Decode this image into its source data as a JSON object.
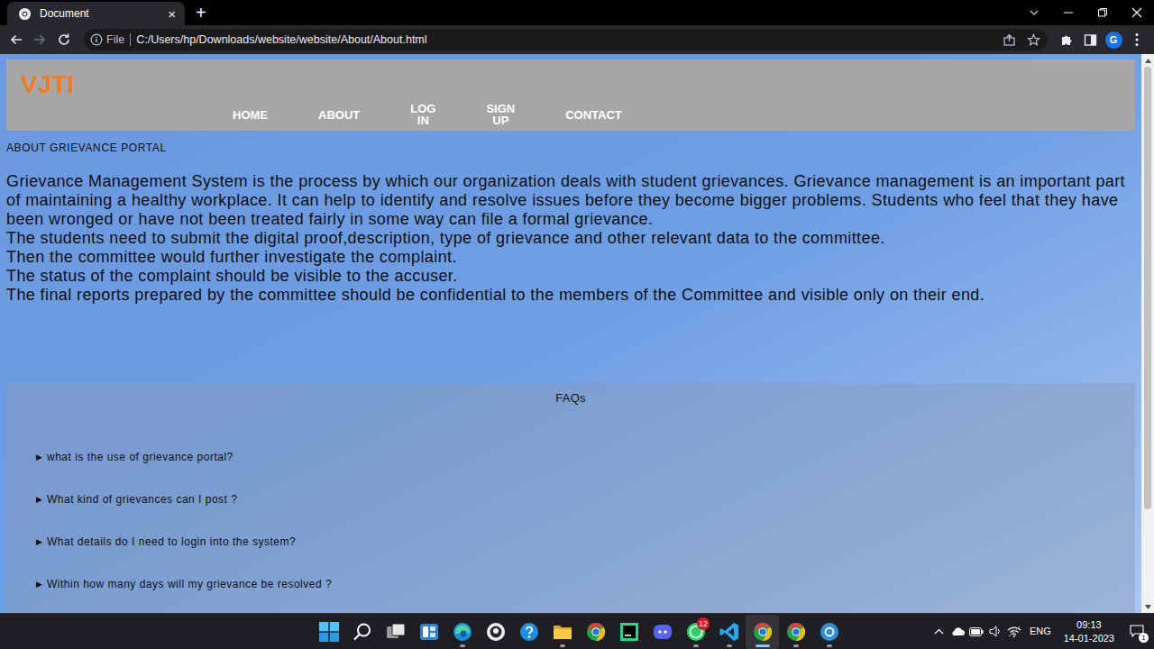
{
  "browser": {
    "tabs": [
      {
        "title": "Document",
        "close": "×",
        "selected": true
      }
    ],
    "new_tab": "+",
    "back_enabled": true,
    "forward_enabled": false,
    "address": {
      "scheme": "File",
      "url": "C:/Users/hp/Downloads/website/website/About/About.html"
    },
    "profile": "G"
  },
  "page": {
    "logo": "VJTI",
    "nav": [
      {
        "label": "HOME"
      },
      {
        "label": "ABOUT"
      },
      {
        "label": "LOG IN"
      },
      {
        "label": "SIGN UP"
      },
      {
        "label": "CONTACT"
      }
    ],
    "section_label": "ABOUT GRIEVANCE PORTAL",
    "paragraph_lines": [
      "Grievance Management System is the process by which our organization deals with student grievances. Grievance management is an important part of maintaining a healthy workplace. It can help to identify and resolve issues before they become bigger problems. Students who feel that they have been wronged or have not been treated fairly in some way can file a formal grievance.",
      "The students need to submit the digital proof,description, type of grievance and other relevant data to the committee.",
      "Then the committee would further investigate the complaint.",
      "The status of the complaint should be visible to the accuser.",
      "The final reports prepared by the committee should be confidential to the members of the Committee and visible only on their end."
    ],
    "faq": {
      "title": "FAQs",
      "items": [
        {
          "marker": "▶",
          "question": "what is the use of grievance portal?",
          "expanded": false
        },
        {
          "marker": "▶",
          "question": "What kind of grievances can I post ?",
          "expanded": false
        },
        {
          "marker": "▶",
          "question": "What details do I need to login into the system?",
          "expanded": false
        },
        {
          "marker": "▶",
          "question": "Within how many days will my grievance be resolved ?",
          "expanded": false
        }
      ]
    },
    "scrollbar": {
      "offset": 0,
      "level": 0.83
    }
  },
  "taskbar": {
    "apps": [
      {
        "kind": "start",
        "open": false,
        "active": false
      },
      {
        "kind": "search",
        "open": false,
        "active": false
      },
      {
        "kind": "taskview",
        "open": false,
        "active": false
      },
      {
        "kind": "widgets",
        "open": false,
        "active": false
      },
      {
        "kind": "edge",
        "open": true,
        "active": false
      },
      {
        "kind": "github",
        "open": false,
        "active": false
      },
      {
        "kind": "help",
        "open": false,
        "active": false
      },
      {
        "kind": "explorer",
        "open": true,
        "active": false
      },
      {
        "kind": "chrome",
        "open": false,
        "active": false
      },
      {
        "kind": "pycharm",
        "open": false,
        "active": false
      },
      {
        "kind": "discord",
        "open": false,
        "active": false
      },
      {
        "kind": "whatsapp",
        "open": true,
        "active": false,
        "badge": "12"
      },
      {
        "kind": "vscode",
        "open": true,
        "active": false
      },
      {
        "kind": "chrome",
        "open": true,
        "active": true
      },
      {
        "kind": "chrome",
        "open": true,
        "active": false
      },
      {
        "kind": "canva",
        "open": true,
        "active": false
      }
    ],
    "language": "ENG",
    "time": "09:13",
    "date": "14-01-2023",
    "notifications": "1"
  }
}
